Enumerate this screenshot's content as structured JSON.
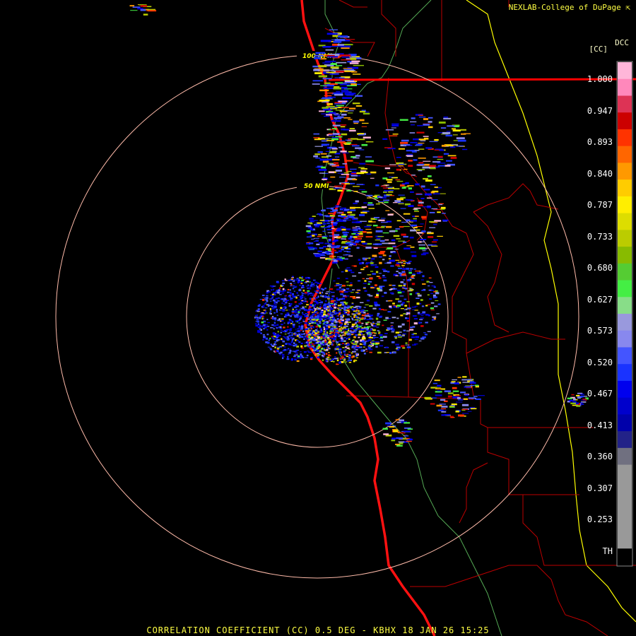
{
  "header": {
    "credit": "NEXLAB-College of DuPage",
    "credit_icon": "corner-arrow-icon"
  },
  "footer": {
    "title": "CORRELATION COEFFICIENT (CC) 0.5 DEG - KBHX 18 JAN 26 15:25"
  },
  "legend": {
    "product_name": "DCC",
    "product_abbr": "[CC]",
    "labels": [
      "1.000",
      "0.947",
      "0.893",
      "0.840",
      "0.787",
      "0.733",
      "0.680",
      "0.627",
      "0.573",
      "0.520",
      "0.467",
      "0.413",
      "0.360",
      "0.307",
      "0.253",
      "TH"
    ],
    "colors": [
      "#ffb6d9",
      "#ff88bb",
      "#dd3355",
      "#cc0000",
      "#ff3300",
      "#ff6600",
      "#ff9900",
      "#ffcc00",
      "#ffee00",
      "#dddd00",
      "#bbcc00",
      "#88bb00",
      "#55cc33",
      "#44ee44",
      "#88dd88",
      "#9999dd",
      "#8888ee",
      "#4455ff",
      "#1a33ff",
      "#0000ee",
      "#0000cc",
      "#0000aa",
      "#222288",
      "#707080",
      "#999999",
      "#999999",
      "#999999",
      "#999999",
      "#999999",
      "#000000"
    ]
  },
  "range_rings": [
    {
      "label": "50 NMI"
    },
    {
      "label": "100 NMI"
    }
  ],
  "colors": {
    "background": "#000000",
    "text": "#ffff44",
    "ring": "#ffbbaa",
    "county_border": "#cc0000",
    "state_border": "#ff0000",
    "coastline": "#ff1111",
    "boundary_yellow": "#ffff00",
    "boundary_green": "#66cc66"
  }
}
